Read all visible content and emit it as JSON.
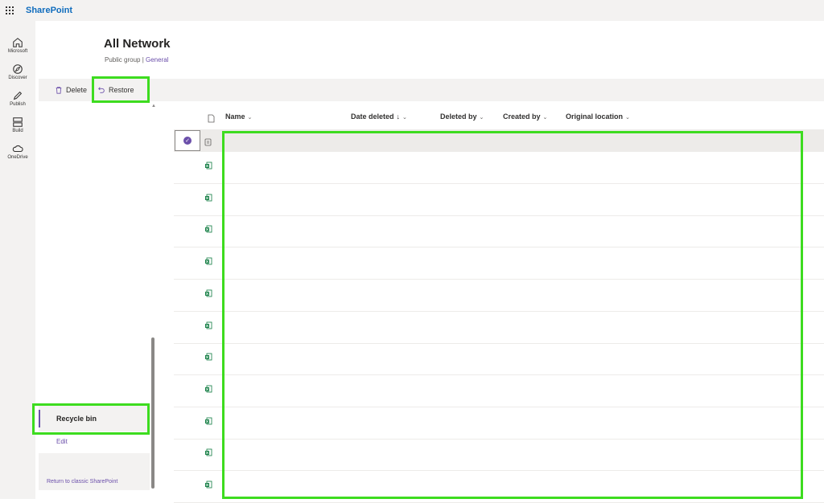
{
  "app": {
    "title": "SharePoint"
  },
  "rail": {
    "items": [
      {
        "label": "Microsoft",
        "icon": "home-icon"
      },
      {
        "label": "Discover",
        "icon": "compass-icon"
      },
      {
        "label": "Publish",
        "icon": "pencil-icon"
      },
      {
        "label": "Build",
        "icon": "build-icon"
      },
      {
        "label": "OneDrive",
        "icon": "cloud-icon"
      }
    ]
  },
  "site": {
    "title": "All Network",
    "group_text": "Public group | ",
    "group_link": "General"
  },
  "commands": {
    "delete_label": "Delete",
    "restore_label": "Restore"
  },
  "nav": {
    "recycle_bin": "Recycle bin",
    "edit": "Edit",
    "return_classic": "Return to classic SharePoint"
  },
  "list": {
    "columns": [
      {
        "label": "Name",
        "chevron": "⌄"
      },
      {
        "label": "Date deleted",
        "sort": "↓",
        "chevron": "⌄"
      },
      {
        "label": "Deleted by",
        "chevron": "⌄"
      },
      {
        "label": "Created by",
        "chevron": "⌄"
      },
      {
        "label": "Original location",
        "chevron": "⌄"
      }
    ],
    "row_count": 12,
    "icon_accent": "#107c41"
  },
  "colors": {
    "accent": "#6b4faa",
    "brand": "#0f6cbd",
    "highlight": "#3ddc1f"
  }
}
